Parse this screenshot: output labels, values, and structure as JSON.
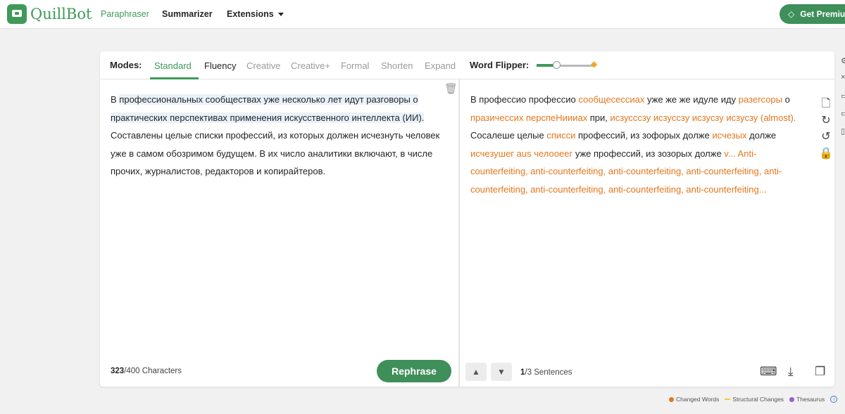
{
  "brand": {
    "name": "QuillBot"
  },
  "nav": {
    "paraphraser": "Paraphraser",
    "summarizer": "Summarizer",
    "extensions": "Extensions",
    "premium": "Get Premium"
  },
  "modes": {
    "label": "Modes:",
    "items": [
      "Standard",
      "Fluency",
      "Creative",
      "Creative+",
      "Formal",
      "Shorten",
      "Expand"
    ],
    "active": "Standard"
  },
  "word_flipper": {
    "label": "Word Flipper:",
    "level": 0.35
  },
  "input": {
    "segments": [
      {
        "text": "В ",
        "hl": false
      },
      {
        "text": "профессиональных сообществах уже несколько лет идут разговоры о практических перспективах применения искусственного интеллекта (ИИ).",
        "hl": true
      },
      {
        "text": " Составлены целые списки профессий, из которых должен исчезнуть человек уже в самом обозримом будущем. В их число аналитики включают, в числе прочих, журналистов, редакторов и копирайтеров.",
        "hl": false
      }
    ],
    "char_count": "323",
    "char_limit": "/400 Characters",
    "rephrase": "Rephrase"
  },
  "output": {
    "segments": [
      {
        "text": "В профессио профессио ",
        "changed": false
      },
      {
        "text": "сообщесессиах",
        "changed": true
      },
      {
        "text": " уже же же идуле иду ",
        "changed": false
      },
      {
        "text": "разегсоры",
        "changed": true
      },
      {
        "text": " о ",
        "changed": false
      },
      {
        "text": "празичессих перспеНиииах",
        "changed": true
      },
      {
        "text": " при, ",
        "changed": false
      },
      {
        "text": "иcзуссcзу иcзуccзу иcзуcзу иcзуcзу (almost).",
        "changed": true
      },
      {
        "text": " Сосалеше целые ",
        "changed": false
      },
      {
        "text": "списси",
        "changed": true
      },
      {
        "text": " профессий, из зофорых долже ",
        "changed": false
      },
      {
        "text": "исчезых",
        "changed": true
      },
      {
        "text": " долже ",
        "changed": false
      },
      {
        "text": "исчезушег aus челооеег",
        "changed": true
      },
      {
        "text": " уже профессий, из зозорых долже ",
        "changed": false
      },
      {
        "text": "v... Anti-counterfeiting, anti-counterfeiting, anti-counterfeiting, anti-counterfeiting, anti-counterfeiting, anti-counterfeiting, anti-counterfeiting, anti-counterfeiting...",
        "changed": true
      }
    ],
    "sentence_current": "1",
    "sentence_total": "/3 Sentences"
  },
  "legend": {
    "changed_words": "Changed Words",
    "structural_changes": "Structural Changes",
    "thesaurus": "Thesaurus"
  },
  "colors": {
    "brand": "#3f9a5a",
    "changed": "#e4761c",
    "structural": "#f5c64a",
    "thesaurus": "#9c5ad6",
    "info": "#3b7bd4"
  }
}
